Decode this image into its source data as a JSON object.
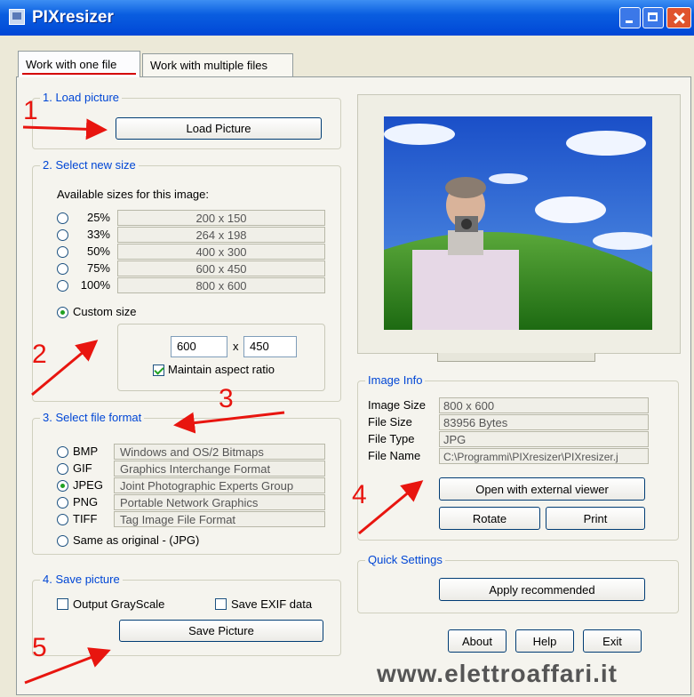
{
  "window": {
    "title": "PIXresizer"
  },
  "tabs": [
    "Work with one file",
    "Work with multiple files"
  ],
  "load": {
    "group_label": "1. Load picture",
    "button": "Load Picture"
  },
  "size": {
    "group_label": "2. Select new size",
    "available_label": "Available sizes for this image:",
    "options": [
      {
        "percent": "25%",
        "dims": "200 x 150"
      },
      {
        "percent": "33%",
        "dims": "264 x 198"
      },
      {
        "percent": "50%",
        "dims": "400 x 300"
      },
      {
        "percent": "75%",
        "dims": "600 x 450"
      },
      {
        "percent": "100%",
        "dims": "800 x 600"
      }
    ],
    "custom_label": "Custom size",
    "width": "600",
    "times": "x",
    "height": "450",
    "maintain_label": "Maintain aspect ratio"
  },
  "format": {
    "group_label": "3. Select file format",
    "options": [
      {
        "name": "BMP",
        "desc": "Windows and OS/2 Bitmaps"
      },
      {
        "name": "GIF",
        "desc": "Graphics Interchange Format"
      },
      {
        "name": "JPEG",
        "desc": "Joint Photographic Experts Group"
      },
      {
        "name": "PNG",
        "desc": "Portable Network Graphics"
      },
      {
        "name": "TIFF",
        "desc": "Tag Image File Format"
      }
    ],
    "same_label": "Same as original  - (JPG)"
  },
  "save": {
    "group_label": "4. Save picture",
    "grayscale_label": "Output GrayScale",
    "exif_label": "Save EXIF data",
    "button": "Save Picture"
  },
  "info": {
    "group_label": "Image Info",
    "rows": [
      {
        "label": "Image Size",
        "value": "800 x 600"
      },
      {
        "label": "File Size",
        "value": "83956 Bytes"
      },
      {
        "label": "File Type",
        "value": "JPG"
      },
      {
        "label": "File Name",
        "value": "C:\\Programmi\\PIXresizer\\PIXresizer.j"
      }
    ],
    "open_button": "Open with external viewer",
    "rotate_button": "Rotate",
    "print_button": "Print"
  },
  "quick": {
    "group_label": "Quick Settings",
    "apply_button": "Apply recommended"
  },
  "footer": {
    "about": "About",
    "help": "Help",
    "exit": "Exit"
  },
  "annotations": [
    "1",
    "2",
    "3",
    "4",
    "5"
  ],
  "watermark": "www.elettroaffari.it",
  "colors": {
    "titlebar": "#0a5ee0",
    "group_label": "#0046d5",
    "annotation": "#e8150f",
    "radio_selected": "#21a121"
  }
}
